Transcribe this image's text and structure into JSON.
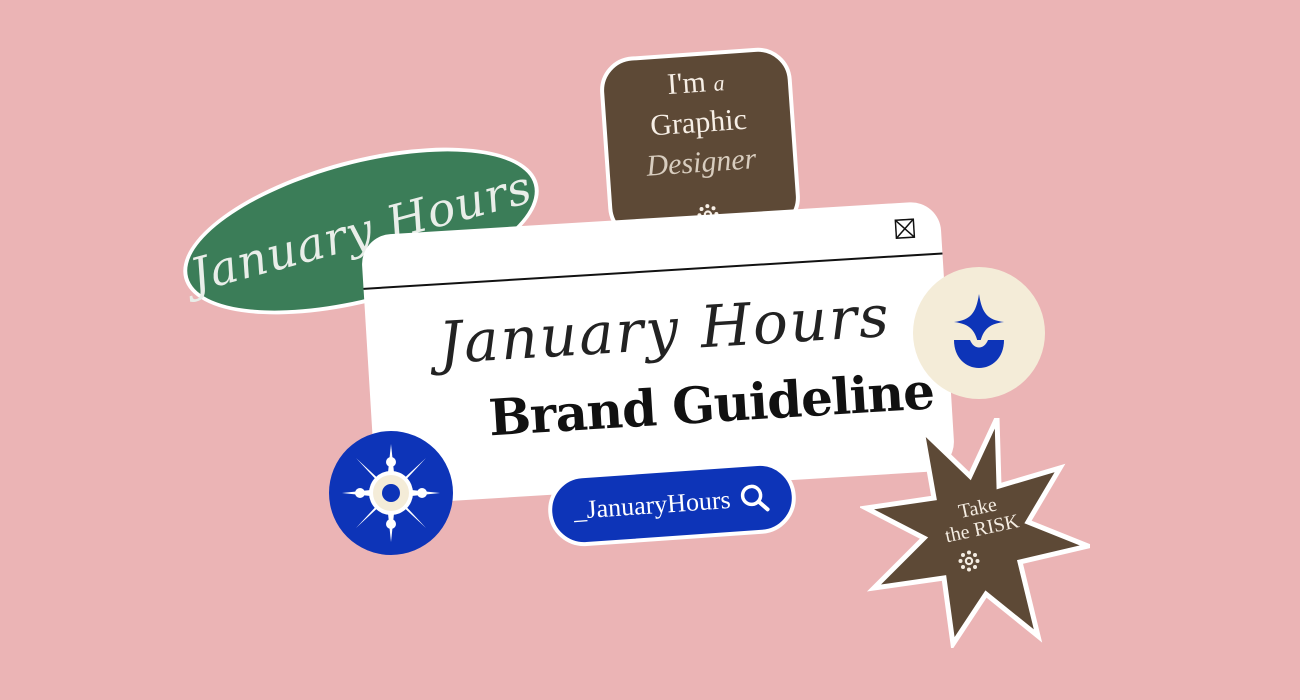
{
  "colors": {
    "background": "#ebb4b5",
    "green": "#3b7d58",
    "brown": "#5d4936",
    "blue": "#0d34b8",
    "cream": "#f4ecd8",
    "white": "#ffffff"
  },
  "oval_sticker": {
    "text": "January Hours"
  },
  "designer_sticker": {
    "line1": "I'm",
    "line1_small": "a",
    "line2": "Graphic",
    "line3": "Designer",
    "icon": "sun-gear-icon"
  },
  "window": {
    "script_title": "January Hours",
    "headline": "Brand Guideline",
    "close_icon": "close-box-icon"
  },
  "search": {
    "tag": "_JanuaryHours",
    "icon": "search-icon"
  },
  "badges": {
    "blue": "flower-badge-icon",
    "cream": "sparkle-bowl-icon"
  },
  "star_sticker": {
    "line1": "Take",
    "line2": "the RISK",
    "icon": "sun-gear-icon"
  }
}
